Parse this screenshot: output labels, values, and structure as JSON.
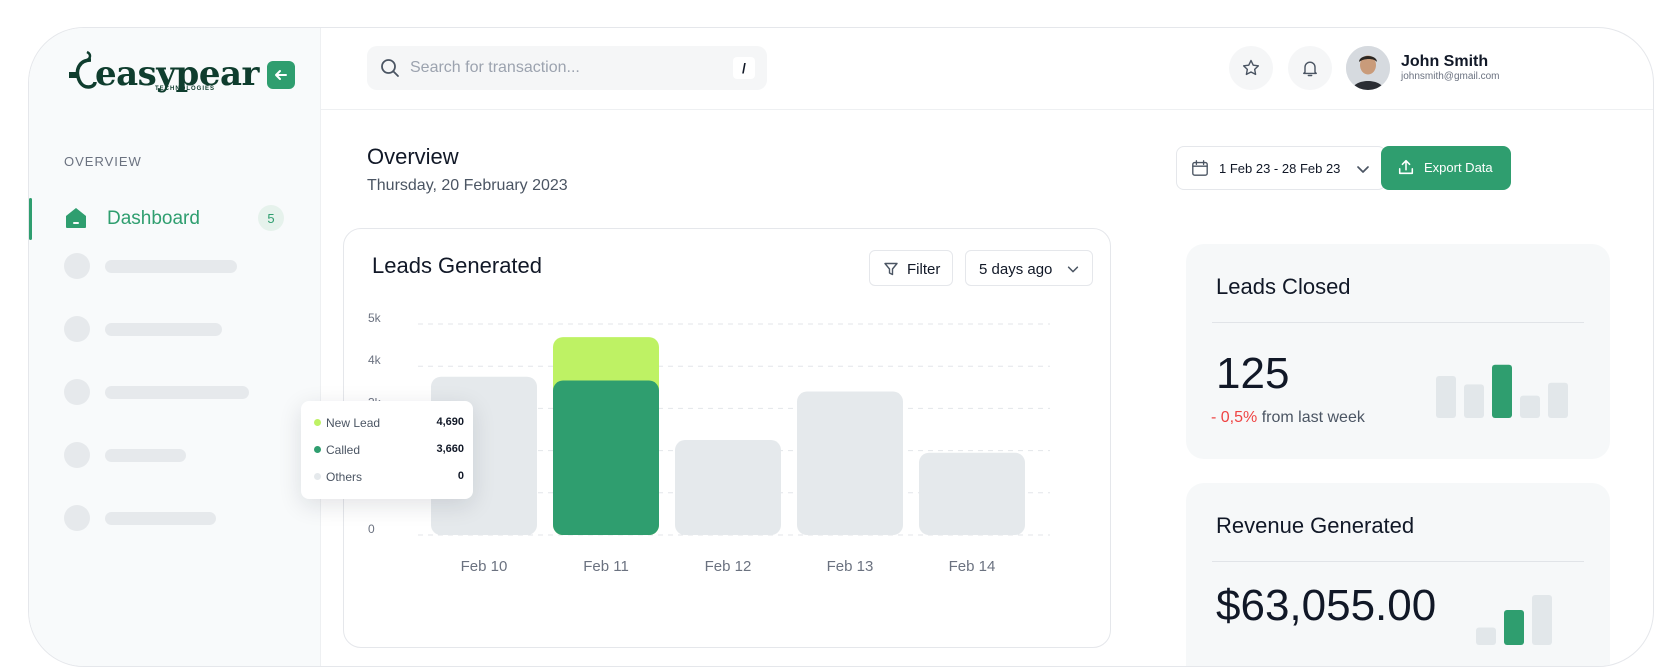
{
  "sidebar": {
    "logo_text": "easypear",
    "logo_sub": "TECHNOLOGIES",
    "section_label": "OVERVIEW",
    "active_item": {
      "label": "Dashboard",
      "badge": "5"
    },
    "placeholder_items": 5
  },
  "header": {
    "search": {
      "placeholder": "Search for transaction...",
      "value": "",
      "shortcut": "/"
    },
    "user": {
      "name": "John Smith",
      "email": "johnsmith@gmail.com"
    }
  },
  "overview": {
    "title": "Overview",
    "date": "Thursday, 20 February 2023",
    "date_range": "1 Feb 23 - 28 Feb 23",
    "export_label": "Export Data"
  },
  "leads_card": {
    "title": "Leads Generated",
    "filter_label": "Filter",
    "range_label": "5 days ago"
  },
  "chart_data": {
    "type": "bar",
    "categories": [
      "Feb 10",
      "Feb 11",
      "Feb 12",
      "Feb 13",
      "Feb 14"
    ],
    "yticks": [
      "0",
      "1k",
      "2k",
      "3k",
      "4k",
      "5k"
    ],
    "ylim": [
      0,
      5000
    ],
    "grid": true,
    "series": [
      {
        "name": "New Lead",
        "color": "#bef264",
        "values": [
          null,
          4690,
          null,
          null,
          null
        ]
      },
      {
        "name": "Called",
        "color": "#2f9e6f",
        "values": [
          null,
          3660,
          null,
          null,
          null
        ]
      },
      {
        "name": "Others",
        "color": "#e5e9ec",
        "values": [
          3750,
          0,
          2250,
          3400,
          1950
        ]
      }
    ],
    "highlight_category": "Feb 11",
    "tooltip": [
      {
        "name": "New Lead",
        "value": "4,690"
      },
      {
        "name": "Called",
        "value": "3,660"
      },
      {
        "name": "Others",
        "value": "0"
      }
    ]
  },
  "leads_closed": {
    "title": "Leads Closed",
    "value": "125",
    "delta": "- 0,5%",
    "delta_suffix": "from last week",
    "bar_values": [
      0.75,
      0.6,
      0.95,
      0.4,
      0.63
    ]
  },
  "revenue": {
    "title": "Revenue Generated",
    "value": "$63,055.00",
    "bar_values": [
      0.35,
      0.7,
      1.0
    ]
  },
  "colors": {
    "accent": "#2f9e6f",
    "lime": "#bef264",
    "negative": "#ef4444"
  }
}
